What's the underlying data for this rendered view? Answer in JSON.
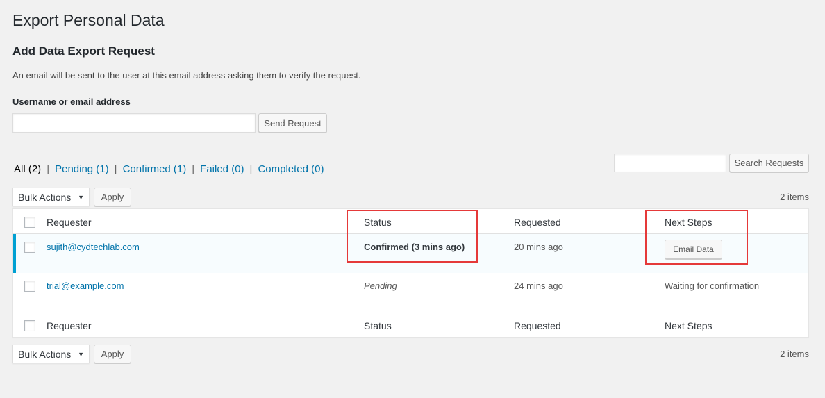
{
  "page": {
    "title": "Export Personal Data",
    "section_title": "Add Data Export Request",
    "description": "An email will be sent to the user at this email address asking them to verify the request.",
    "field_label": "Username or email address",
    "field_value": "",
    "send_button": "Send Request"
  },
  "filters": {
    "all": "All",
    "all_count": "(2)",
    "pending": "Pending (1)",
    "confirmed": "Confirmed (1)",
    "failed": "Failed (0)",
    "completed": "Completed (0)",
    "separator": "|"
  },
  "search": {
    "value": "",
    "button": "Search Requests"
  },
  "bulk_top": {
    "select_value": "Bulk Actions",
    "apply": "Apply",
    "count": "2 items"
  },
  "bulk_bottom": {
    "select_value": "Bulk Actions",
    "apply": "Apply",
    "count": "2 items"
  },
  "table": {
    "columns": [
      "Requester",
      "Status",
      "Requested",
      "Next Steps"
    ],
    "rows": [
      {
        "requester": "sujith@cydtechlab.com",
        "status": "Confirmed (3 mins ago)",
        "requested": "20 mins ago",
        "next_step_button": "Email Data"
      },
      {
        "requester": "trial@example.com",
        "status": "Pending",
        "requested": "24 mins ago",
        "next_step_text": "Waiting for confirmation"
      }
    ]
  },
  "icons": {
    "select_arrow": "caret-down-icon",
    "row_checkbox": "checkbox-icon"
  },
  "colors": {
    "link": "#0073aa",
    "active_row_border": "#00a0d2",
    "annotation": "#e53939",
    "background": "#f1f1f1"
  }
}
